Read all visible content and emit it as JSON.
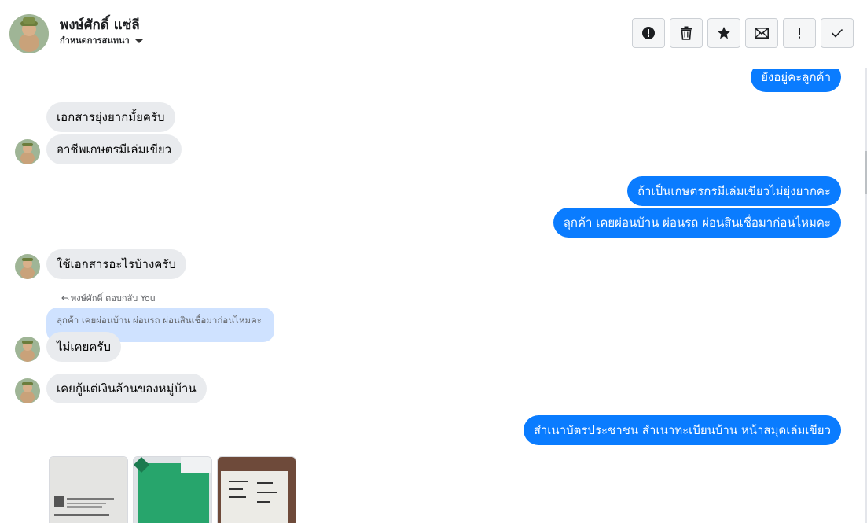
{
  "header": {
    "contact_name": "พงษ์ศักดิ์ แซ่ลี",
    "assign_label": "กำหนดการสนทนา",
    "actions": [
      {
        "icon": "alert-circle-icon",
        "name": "spam-button"
      },
      {
        "icon": "trash-icon",
        "name": "delete-button"
      },
      {
        "icon": "star-icon",
        "name": "star-button"
      },
      {
        "icon": "envelope-icon",
        "name": "mark-unread-button"
      },
      {
        "icon": "exclamation-icon",
        "name": "follow-up-button"
      },
      {
        "icon": "checkmark-icon",
        "name": "done-button"
      }
    ]
  },
  "messages": {
    "m1": "ยังอยู่คะลูกค้า",
    "m2": "เอกสารยุ่งยากมั้ยครับ",
    "m3": "อาชีพเกษตรมีเล่มเขียว",
    "m4": "ถ้าเป็นเกษตรกรมีเล่มเขียวไม่ยุ่งยากคะ",
    "m5": "ลุกค้า เคยผ่อนบ้าน ผ่อนรถ ผ่อนสินเชื่อมาก่อนไหมคะ",
    "m6": "ใช้เอกสารอะไรบ้างครับ",
    "reply_meta": "พงษ์ศักดิ์ ตอบกลับ You",
    "quoted": "ลุกค้า เคยผ่อนบ้าน ผ่อนรถ ผ่อนสินเชื่อมาก่อนไหมคะ",
    "m7": "ไม่เคยครับ",
    "m8": "เคยกู้แต่เงินล้านของหมู่บ้าน",
    "m9": "สำเนาบัตรประชาชน สำเนาทะเบียนบ้าน  หน้าสมุดเล่มเขียว"
  },
  "colors": {
    "outgoing": "#0a7cff",
    "incoming": "#e9ebee",
    "quoted": "#cfe2ff"
  }
}
